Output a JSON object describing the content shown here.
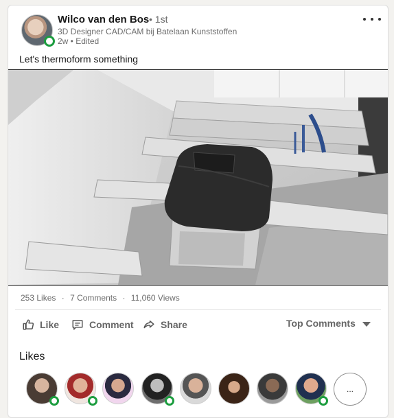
{
  "author": {
    "name": "Wilco van den Bos",
    "degree": "• 1st",
    "headline": "3D Designer CAD/CAM bij Batelaan Kunststoffen",
    "meta": "2w • Edited"
  },
  "post": {
    "text": "Let's thermoform something"
  },
  "stats": {
    "likes": "253 Likes",
    "comments": "7 Comments",
    "views": "11,060 Views",
    "separator": "·"
  },
  "actions": {
    "like": "Like",
    "comment": "Comment",
    "share": "Share",
    "sort": "Top Comments"
  },
  "likes_section": {
    "title": "Likes",
    "more": "..."
  },
  "colors": {
    "presence_green": "#1c9d3f",
    "text_muted": "#6b6b6b"
  }
}
